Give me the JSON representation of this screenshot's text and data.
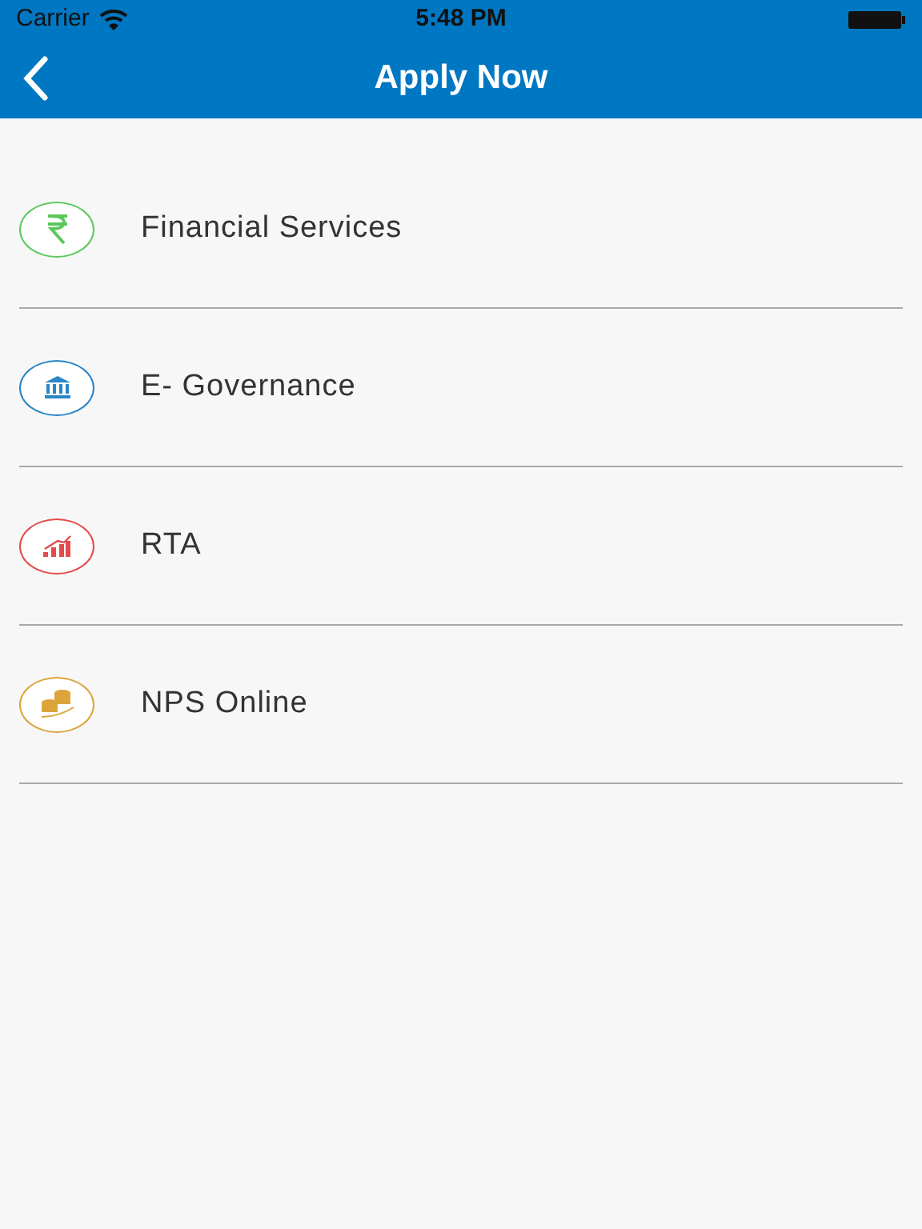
{
  "status_bar": {
    "carrier": "Carrier",
    "time": "5:48 PM"
  },
  "header": {
    "title": "Apply Now"
  },
  "items": [
    {
      "label": "Financial Services",
      "kind": "rupee",
      "color": "#5cc85c"
    },
    {
      "label": "E- Governance",
      "kind": "bank",
      "color": "#2a86c8"
    },
    {
      "label": "RTA",
      "kind": "chart",
      "color": "#e34b4b"
    },
    {
      "label": "NPS Online",
      "kind": "coins",
      "color": "#dca53c"
    }
  ]
}
